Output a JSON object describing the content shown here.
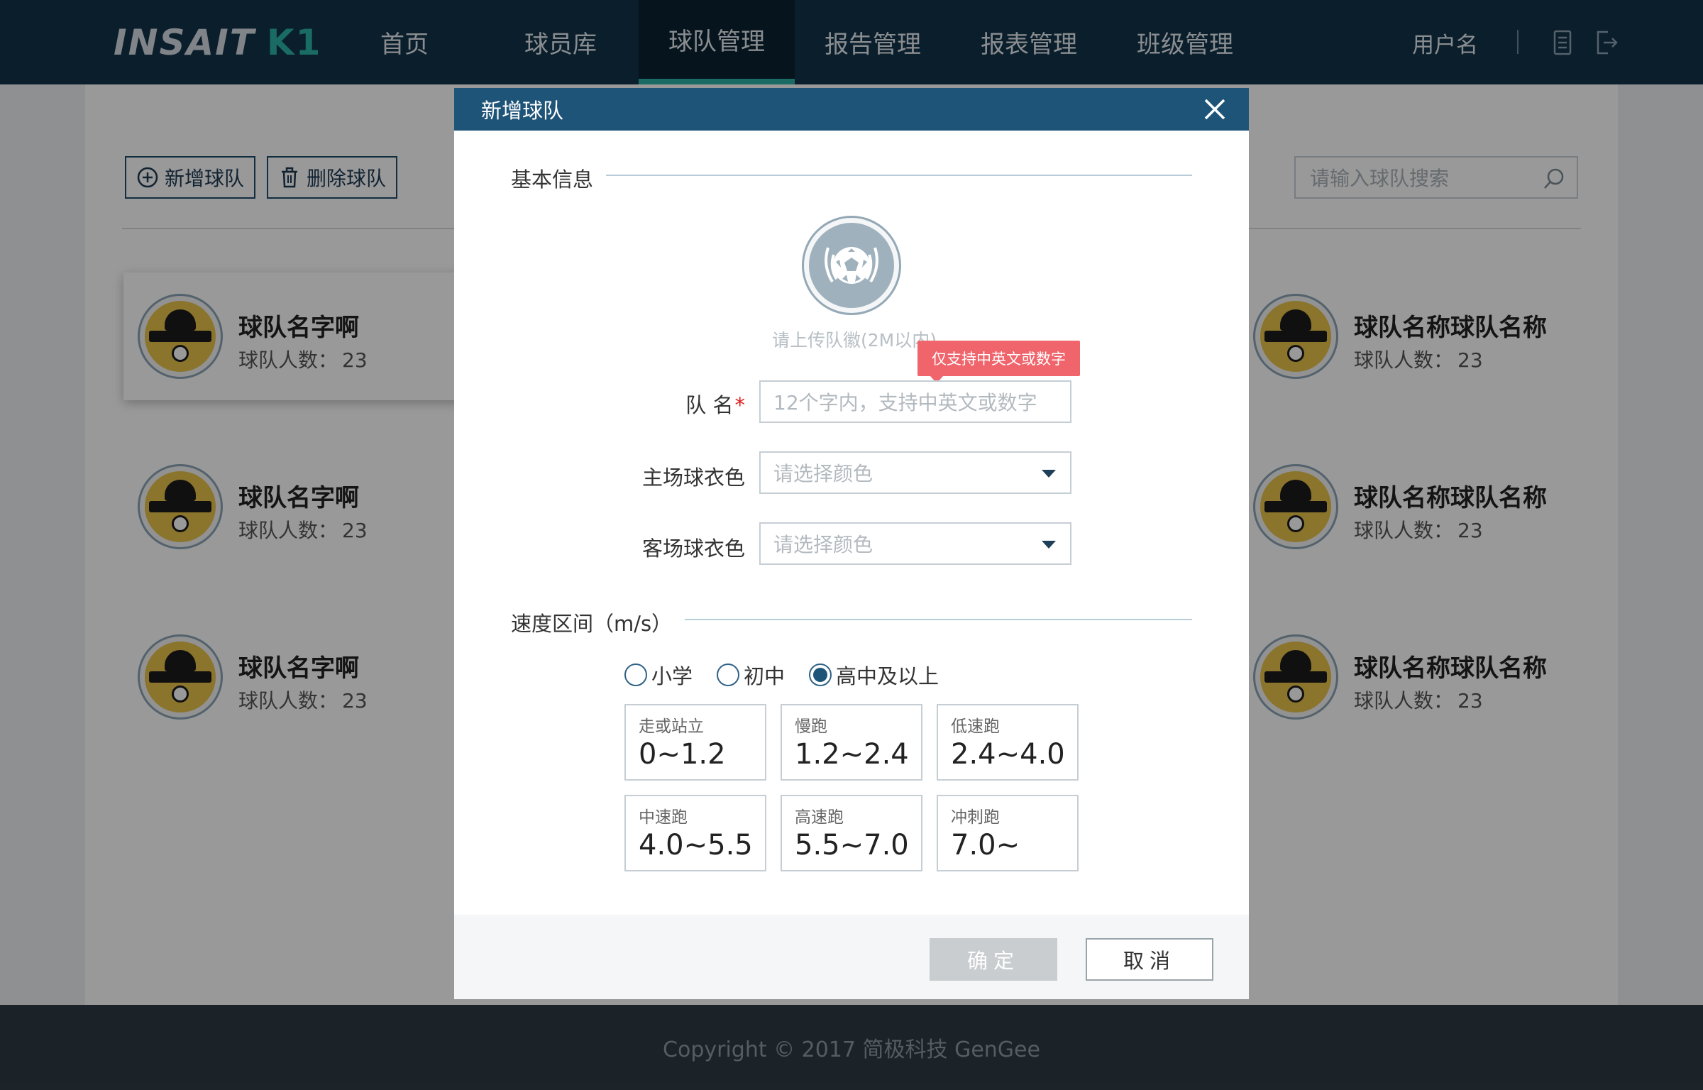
{
  "header": {
    "logo_main": "INSAIT",
    "logo_suffix": "K1",
    "nav": [
      {
        "label": "首页"
      },
      {
        "label": "球员库"
      },
      {
        "label": "球队管理",
        "active": true
      },
      {
        "label": "报告管理"
      },
      {
        "label": "报表管理"
      },
      {
        "label": "班级管理"
      }
    ],
    "username": "用户名",
    "icons": [
      "document-icon",
      "logout-icon"
    ]
  },
  "toolbar": {
    "add_label": "新增球队",
    "delete_label": "删除球队",
    "search_placeholder": "请输入球队搜索"
  },
  "teams": {
    "left": [
      {
        "name": "球队名字啊",
        "count_label": "球队人数：",
        "count": "23"
      },
      {
        "name": "球队名字啊",
        "count_label": "球队人数：",
        "count": "23"
      },
      {
        "name": "球队名字啊",
        "count_label": "球队人数：",
        "count": "23"
      }
    ],
    "right": [
      {
        "name": "球队名称球队名称",
        "count_label": "球队人数：",
        "count": "23"
      },
      {
        "name": "球队名称球队名称",
        "count_label": "球队人数：",
        "count": "23"
      },
      {
        "name": "球队名称球队名称",
        "count_label": "球队人数：",
        "count": "23"
      }
    ]
  },
  "footer": {
    "text": "Copyright © 2017 简极科技 GenGee"
  },
  "modal": {
    "title": "新增球队",
    "basic_section": "基本信息",
    "upload_hint": "请上传队徽(2M以内)",
    "tooltip": "仅支持中英文或数字",
    "name_label": "队 名",
    "required_mark": "*",
    "name_placeholder": "12个字内，支持中英文或数字",
    "home_label": "主场球衣色",
    "home_placeholder": "请选择颜色",
    "away_label": "客场球衣色",
    "away_placeholder": "请选择颜色",
    "speed_section": "速度区间（m/s）",
    "levels": [
      {
        "label": "小学",
        "selected": false
      },
      {
        "label": "初中",
        "selected": false
      },
      {
        "label": "高中及以上",
        "selected": true
      }
    ],
    "speeds": [
      {
        "label": "走或站立",
        "value": "0~1.2"
      },
      {
        "label": "慢跑",
        "value": "1.2~2.4"
      },
      {
        "label": "低速跑",
        "value": "2.4~4.0"
      },
      {
        "label": "中速跑",
        "value": "4.0~5.5"
      },
      {
        "label": "高速跑",
        "value": "5.5~7.0"
      },
      {
        "label": "冲刺跑",
        "value": "7.0~"
      }
    ],
    "confirm_label": "确定",
    "cancel_label": "取消"
  },
  "colors": {
    "topbar": "#12324a",
    "accent": "#2ab3a6",
    "modal_header": "#1f5479",
    "tooltip": "#f0646c",
    "required": "#e02020"
  }
}
